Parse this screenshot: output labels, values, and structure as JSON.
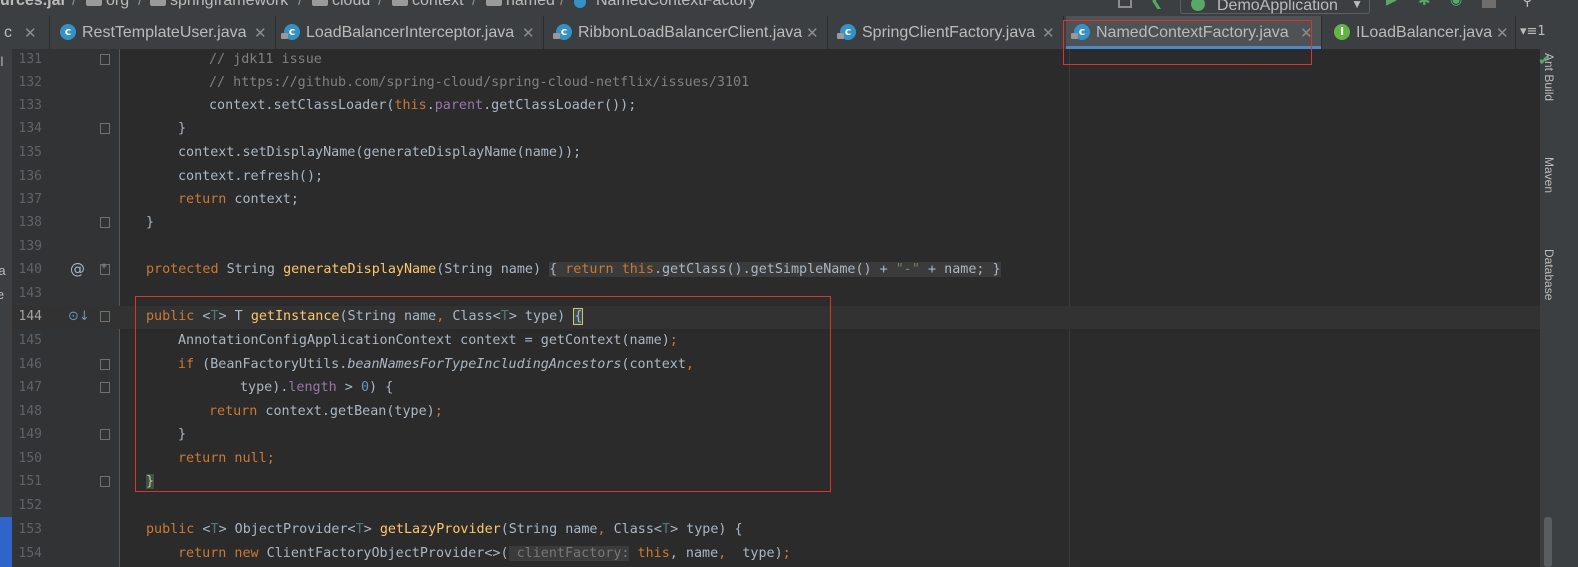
{
  "breadcrumb": {
    "items": [
      "urces.jar",
      "org",
      "springframework",
      "cloud",
      "context",
      "named",
      "NamedContextFactory"
    ],
    "separator": "/"
  },
  "run_config": {
    "label": "DemoApplication"
  },
  "tabs": {
    "partial": "c",
    "items": [
      {
        "label": "RestTemplateUser.java",
        "icon": "class-icon"
      },
      {
        "label": "LoadBalancerInterceptor.java",
        "icon": "class-icon"
      },
      {
        "label": "RibbonLoadBalancerClient.java",
        "icon": "class-icon"
      },
      {
        "label": "SpringClientFactory.java",
        "icon": "class-icon"
      },
      {
        "label": "NamedContextFactory.java",
        "icon": "class-icon",
        "active": true
      },
      {
        "label": "ILoadBalancer.java",
        "icon": "interface-icon"
      }
    ],
    "overflow": "▾≡1"
  },
  "side_tools": [
    "Ant Build",
    "Maven",
    "Database"
  ],
  "left_fragments": [
    "cl",
    "ra",
    "le"
  ],
  "code_lines": [
    {
      "n": "131",
      "text": "// jdk11 issue"
    },
    {
      "n": "132",
      "text": "// https://github.com/spring-cloud/spring-cloud-netflix/issues/3101"
    },
    {
      "n": "133",
      "text": "context.setClassLoader(this.parent.getClassLoader());"
    },
    {
      "n": "134",
      "text": "}"
    },
    {
      "n": "135",
      "text": "context.setDisplayName(generateDisplayName(name));"
    },
    {
      "n": "136",
      "text": "context.refresh();"
    },
    {
      "n": "137",
      "text": "return context;"
    },
    {
      "n": "138",
      "text": "}"
    },
    {
      "n": "139",
      "text": ""
    },
    {
      "n": "140",
      "text": "protected String generateDisplayName(String name) { return this.getClass().getSimpleName() + \"-\" + name; }"
    },
    {
      "n": "143",
      "text": ""
    },
    {
      "n": "144",
      "text": "public <T> T getInstance(String name, Class<T> type) {"
    },
    {
      "n": "145",
      "text": "AnnotationConfigApplicationContext context = getContext(name);"
    },
    {
      "n": "146",
      "text": "if (BeanFactoryUtils.beanNamesForTypeIncludingAncestors(context,"
    },
    {
      "n": "147",
      "text": "type).length > 0) {"
    },
    {
      "n": "148",
      "text": "return context.getBean(type);"
    },
    {
      "n": "149",
      "text": "}"
    },
    {
      "n": "150",
      "text": "return null;"
    },
    {
      "n": "151",
      "text": "}"
    },
    {
      "n": "152",
      "text": ""
    },
    {
      "n": "153",
      "text": "public <T> ObjectProvider<T> getLazyProvider(String name, Class<T> type) {"
    },
    {
      "n": "154",
      "text": "return new ClientFactoryObjectProvider<>( clientFactory: this, name, type);"
    }
  ],
  "tokens": {
    "l131": "// jdk11 issue",
    "l132": "// https://github.com/spring-cloud/spring-cloud-netflix/issues/3101",
    "l133a": "context.setClassLoader(",
    "l133b": "this",
    "l133c": ".",
    "l133d": "parent",
    "l133e": ".getClassLoader());",
    "l134": "}",
    "l135": "context.setDisplayName(generateDisplayName(name));",
    "l136": "context.refresh();",
    "l137a": "return",
    "l137b": " context;",
    "l138": "}",
    "l140a": "protected",
    "l140b": " String ",
    "l140c": "generateDisplayName",
    "l140d": "(String name) ",
    "l140e": "{ ",
    "l140f": "return ",
    "l140g": "this",
    "l140h": ".getClass().getSimpleName() + ",
    "l140i": "\"-\"",
    "l140j": " + name; ",
    "l140k": "}",
    "l144a": "public",
    "l144b": " <",
    "l144c": "T",
    "l144d": "> T ",
    "l144e": "getInstance",
    "l144f": "(String name",
    "l144g": ", ",
    "l144h": "Class<",
    "l144i": "T",
    "l144j": "> type) ",
    "l144k": "{",
    "l145a": "AnnotationConfigApplicationContext context = getContext(name)",
    "l145b": ";",
    "l146a": "if",
    "l146b": " (BeanFactoryUtils.",
    "l146c": "beanNamesForTypeIncludingAncestors",
    "l146d": "(context",
    "l146e": ",",
    "l147a": "type).",
    "l147b": "length",
    "l147c": " > ",
    "l147d": "0",
    "l147e": ") {",
    "l148a": "return",
    "l148b": " context.getBean(type)",
    "l148c": ";",
    "l149": "}",
    "l150a": "return null",
    "l150b": ";",
    "l151": "}",
    "l153a": "public",
    "l153b": " <",
    "l153c": "T",
    "l153d": "> ObjectProvider<",
    "l153e": "T",
    "l153f": "> ",
    "l153g": "getLazyProvider",
    "l153h": "(String name",
    "l153i": ", ",
    "l153j": "Class<",
    "l153k": "T",
    "l153l": "> type) {",
    "l154a": "return new",
    "l154b": " ClientFactoryObjectProvider<>(",
    "l154c": " clientFactory:",
    "l154d": " this",
    "l154e": ", name",
    "l154f": ", ",
    "l154g": " type)",
    "l154h": ";"
  },
  "gutter": {
    "override_marker": "@",
    "implements_marker": "⊙↓"
  },
  "colors": {
    "keyword": "#cc7832",
    "comment": "#808080",
    "string": "#6a8759",
    "method": "#ffc66d",
    "field": "#9876aa",
    "type_param": "#507874",
    "highlight_box": "#e0322d",
    "active_tab_underline": "#4a88c7"
  }
}
